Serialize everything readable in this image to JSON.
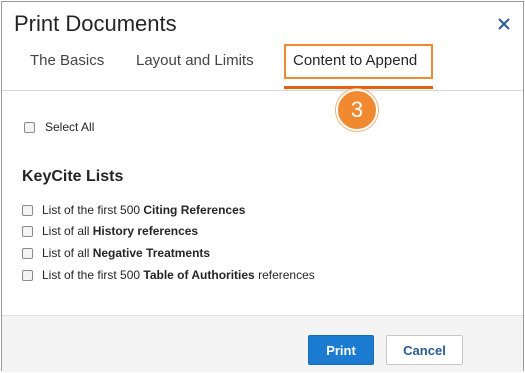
{
  "dialog": {
    "title": "Print Documents",
    "close_icon": "close-icon"
  },
  "tabs": [
    {
      "label": "The Basics",
      "active": false
    },
    {
      "label": "Layout and Limits",
      "active": false
    },
    {
      "label": "Content to Append",
      "active": true
    }
  ],
  "step_badge": "3",
  "select_all": {
    "label": "Select All",
    "checked": false
  },
  "keycite": {
    "heading": "KeyCite Lists",
    "items": [
      {
        "prefix": "List of the first 500 ",
        "bold": "Citing References",
        "suffix": "",
        "checked": false
      },
      {
        "prefix": "List of all ",
        "bold": "History references",
        "suffix": "",
        "checked": false
      },
      {
        "prefix": "List of all ",
        "bold": "Negative Treatments",
        "suffix": "",
        "checked": false
      },
      {
        "prefix": "List of the first 500 ",
        "bold": "Table of Authorities",
        "suffix": " references",
        "checked": false
      }
    ]
  },
  "footer": {
    "print_label": "Print",
    "cancel_label": "Cancel"
  },
  "colors": {
    "accent_orange": "#f0892f",
    "tab_underline": "#e8600f",
    "primary_blue": "#1a7bd1"
  }
}
